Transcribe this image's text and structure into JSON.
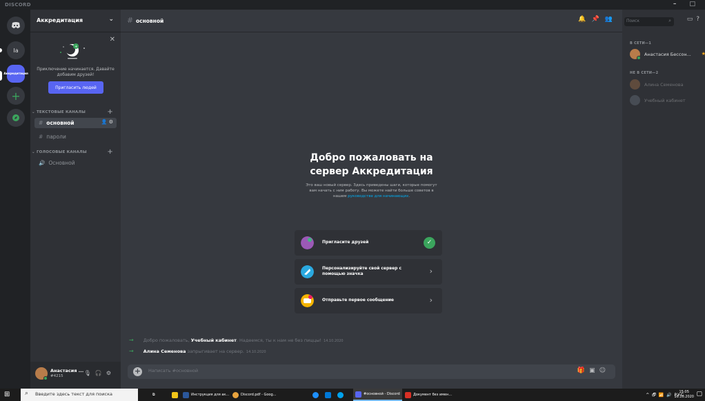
{
  "window": {
    "brand": "DISCORD",
    "controls": "– □"
  },
  "rail": {
    "home_label": "",
    "server1_label": "Ia",
    "active_server_label": "Аккредитация",
    "add_label": "+",
    "explore_label": "●"
  },
  "guild": {
    "name": "Аккредитация",
    "invite_text": "Приключение начинается. Давайте добавим друзей!",
    "invite_button": "Пригласить людей",
    "categories": [
      {
        "name": "ТЕКСТОВЫЕ КАНАЛЫ",
        "channels": [
          {
            "name": "основной",
            "active": true
          },
          {
            "name": "пароли",
            "active": false
          }
        ]
      },
      {
        "name": "ГОЛОСОВЫЕ КАНАЛЫ",
        "channels": [
          {
            "name": "Основной",
            "active": false
          }
        ]
      }
    ]
  },
  "user": {
    "name": "Анастасия ...",
    "tag": "#4215"
  },
  "chat": {
    "channel_name": "основной",
    "welcome_title": "Добро пожаловать на сервер Аккредитация",
    "welcome_desc": "Это ваш новый сервер. Здесь приведены шаги, которые помогут вам начать с ним работу. Вы можете найти больше советов в нашем ",
    "welcome_link": "руководстве для начинающих",
    "welcome_desc_end": ".",
    "steps": [
      {
        "label": "Пригласите друзей",
        "done": true
      },
      {
        "label": "Персонализируйте свой сервер с помощью значка",
        "done": false
      },
      {
        "label": "Отправьте первое сообщение",
        "done": false
      }
    ],
    "messages": [
      {
        "prefix": "Добро пожаловать, ",
        "user": "Учебный кабинет",
        "suffix": ". Надеемся, ты к нам не без пиццы!",
        "ts": "14.10.2020"
      },
      {
        "prefix": "",
        "user": "Алина Семенова",
        "suffix": " запрыгивает на сервер.",
        "ts": "14.10.2020"
      }
    ],
    "composer_placeholder": "Написать #основной"
  },
  "members": {
    "search_placeholder": "Поиск",
    "online_header": "В СЕТИ—1",
    "offline_header": "НЕ В СЕТИ—2",
    "online": [
      {
        "name": "Анастасия Бессон..."
      }
    ],
    "offline": [
      {
        "name": "Алина Семенова"
      },
      {
        "name": "Учебный кабинет"
      }
    ]
  },
  "taskbar": {
    "search_placeholder": "Введите здесь текст для поиска",
    "items": [
      {
        "label": "Инструкция для ак...",
        "color": "#2b579a"
      },
      {
        "label": "Discord.pdf - Goog...",
        "color": "#e8a33d"
      },
      {
        "label": "#основной - Discord",
        "color": "#5865f2"
      },
      {
        "label": "Документ без имен...",
        "color": "#d93025"
      }
    ],
    "tray": "^ 🗗 📶 🔊 РУС",
    "time": "15:05",
    "date": "16.10.2020"
  },
  "colors": {
    "accent": "#5865f2",
    "online": "#3ba55d",
    "link": "#00aff4"
  }
}
